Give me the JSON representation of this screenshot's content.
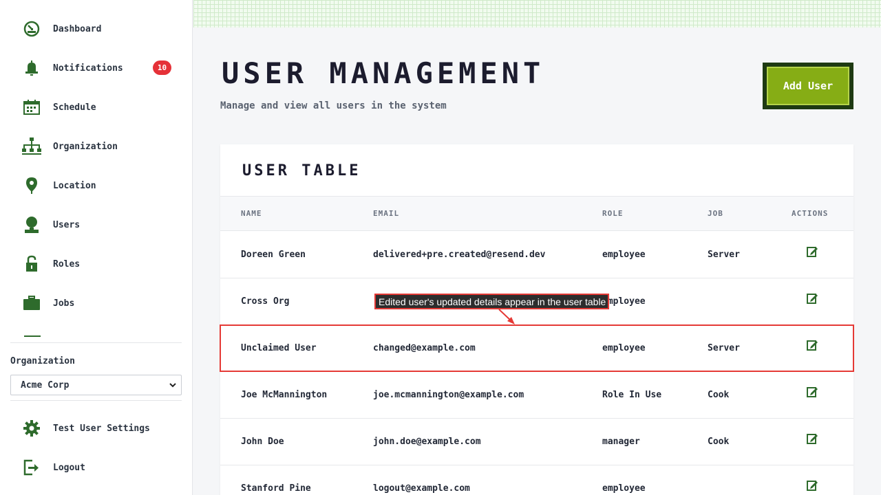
{
  "sidebar": {
    "items": [
      {
        "label": "Dashboard",
        "icon": "dashboard-icon"
      },
      {
        "label": "Notifications",
        "icon": "bell-icon",
        "badge": "10"
      },
      {
        "label": "Schedule",
        "icon": "calendar-icon"
      },
      {
        "label": "Organization",
        "icon": "org-chart-icon"
      },
      {
        "label": "Location",
        "icon": "location-pin-icon"
      },
      {
        "label": "Users",
        "icon": "user-icon"
      },
      {
        "label": "Roles",
        "icon": "lock-icon"
      },
      {
        "label": "Jobs",
        "icon": "briefcase-icon"
      }
    ],
    "organization_label": "Organization",
    "organization_selected": "Acme Corp",
    "bottom_items": [
      {
        "label": "Test User Settings",
        "icon": "gear-icon"
      },
      {
        "label": "Logout",
        "icon": "logout-icon"
      }
    ]
  },
  "header": {
    "title": "User Management",
    "subtitle": "Manage and view all users in the system",
    "add_button": "Add User"
  },
  "table": {
    "title": "User Table",
    "columns": [
      "Name",
      "Email",
      "Role",
      "Job",
      "Actions"
    ],
    "rows": [
      {
        "name": "Doreen Green",
        "email": "delivered+pre.created@resend.dev",
        "role": "employee",
        "job": "Server"
      },
      {
        "name": "Cross Org",
        "email": "",
        "role": "employee",
        "job": ""
      },
      {
        "name": "Unclaimed User",
        "email": "changed@example.com",
        "role": "employee",
        "job": "Server"
      },
      {
        "name": "Joe McMannington",
        "email": "joe.mcmannington@example.com",
        "role": "Role In Use",
        "job": "Cook"
      },
      {
        "name": "John Doe",
        "email": "john.doe@example.com",
        "role": "manager",
        "job": "Cook"
      },
      {
        "name": "Stanford Pine",
        "email": "logout@example.com",
        "role": "employee",
        "job": ""
      }
    ]
  },
  "annotation": {
    "text": "Edited user's updated details appear in the user table"
  },
  "colors": {
    "accent_green": "#86ad15",
    "icon_green": "#2e6b2c",
    "badge_red": "#e53138",
    "annotation_red": "#e53935"
  }
}
